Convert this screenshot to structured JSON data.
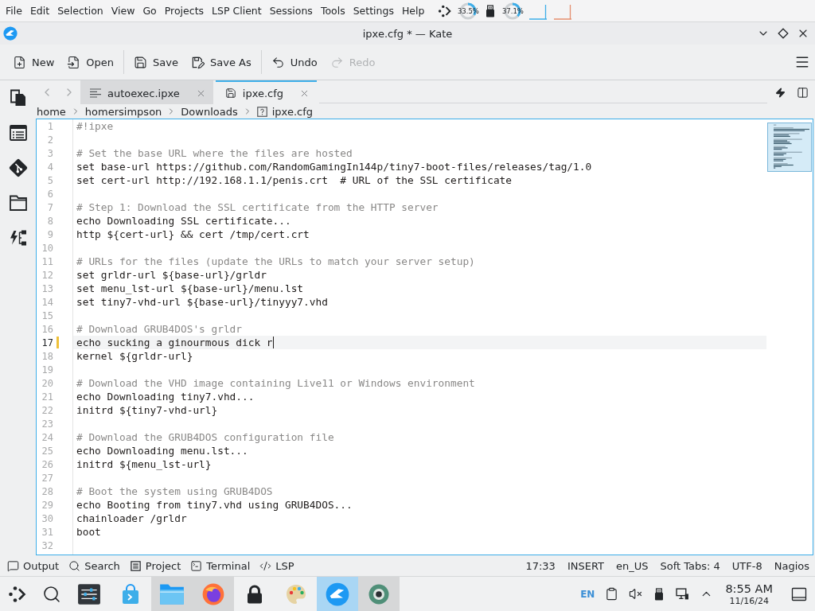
{
  "menu_bar": {
    "items": [
      "File",
      "Edit",
      "Selection",
      "View",
      "Go",
      "Projects",
      "LSP Client",
      "Sessions",
      "Tools",
      "Settings",
      "Help"
    ]
  },
  "system_monitor": {
    "gauges": [
      {
        "reading": "33.5%",
        "level": 0.335
      },
      {
        "reading": "37.1%",
        "level": 0.371
      }
    ]
  },
  "window": {
    "title": "ipxe.cfg * — Kate"
  },
  "toolbar": {
    "groups": [
      [
        {
          "label": "New",
          "disabled": false
        },
        {
          "label": "Open",
          "disabled": false
        }
      ],
      [
        {
          "label": "Save",
          "disabled": false
        },
        {
          "label": "Save As",
          "disabled": false
        }
      ],
      [
        {
          "label": "Undo",
          "disabled": false
        },
        {
          "label": "Redo",
          "disabled": true
        }
      ]
    ]
  },
  "tabs": [
    {
      "label": "autoexec.ipxe",
      "selected": false,
      "modified": false
    },
    {
      "label": "ipxe.cfg",
      "selected": true,
      "modified": true
    }
  ],
  "breadcrumb": [
    "home",
    "homersimpson",
    "Downloads",
    "ipxe.cfg"
  ],
  "editor": {
    "lines": [
      {
        "number": "1",
        "kind": "comment",
        "text": "#!ipxe",
        "current": false,
        "modified": false
      },
      {
        "number": "2",
        "kind": "blank",
        "current": false,
        "modified": false
      },
      {
        "number": "3",
        "kind": "comment",
        "text": "# Set the base URL where the files are hosted",
        "current": false,
        "modified": false
      },
      {
        "number": "4",
        "kind": "code",
        "text": "set base-url https://github.com/RandomGamingIn144p/tiny7-boot-files/releases/tag/1.0",
        "current": false,
        "modified": false
      },
      {
        "number": "5",
        "kind": "code",
        "text": "set cert-url http://192.168.1.1/penis.crt  # URL of the SSL certificate",
        "current": false,
        "modified": false
      },
      {
        "number": "6",
        "kind": "blank",
        "current": false,
        "modified": false
      },
      {
        "number": "7",
        "kind": "comment",
        "text": "# Step 1: Download the SSL certificate from the HTTP server",
        "current": false,
        "modified": false
      },
      {
        "number": "8",
        "kind": "code",
        "text": "echo Downloading SSL certificate...",
        "current": false,
        "modified": false
      },
      {
        "number": "9",
        "kind": "code",
        "text": "http ${cert-url} && cert /tmp/cert.crt",
        "current": false,
        "modified": false
      },
      {
        "number": "10",
        "kind": "blank",
        "current": false,
        "modified": false
      },
      {
        "number": "11",
        "kind": "comment",
        "text": "# URLs for the files (update the URLs to match your server setup)",
        "current": false,
        "modified": false
      },
      {
        "number": "12",
        "kind": "code",
        "text": "set grldr-url ${base-url}/grldr",
        "current": false,
        "modified": false
      },
      {
        "number": "13",
        "kind": "code",
        "text": "set menu_lst-url ${base-url}/menu.lst",
        "current": false,
        "modified": false
      },
      {
        "number": "14",
        "kind": "code",
        "text": "set tiny7-vhd-url ${base-url}/tinyyy7.vhd",
        "current": false,
        "modified": false
      },
      {
        "number": "15",
        "kind": "blank",
        "current": false,
        "modified": false
      },
      {
        "number": "16",
        "kind": "comment",
        "text": "# Download GRUB4DOS's grldr",
        "current": false,
        "modified": false
      },
      {
        "number": "17",
        "kind": "code",
        "text": "echo sucking a ginourmous dick r",
        "current": true,
        "modified": true
      },
      {
        "number": "18",
        "kind": "code",
        "text": "kernel ${grldr-url}",
        "current": false,
        "modified": false
      },
      {
        "number": "19",
        "kind": "blank",
        "current": false,
        "modified": false
      },
      {
        "number": "20",
        "kind": "comment",
        "text": "# Download the VHD image containing Live11 or Windows environment",
        "current": false,
        "modified": false
      },
      {
        "number": "21",
        "kind": "code",
        "text": "echo Downloading tiny7.vhd...",
        "current": false,
        "modified": false
      },
      {
        "number": "22",
        "kind": "code",
        "text": "initrd ${tiny7-vhd-url}",
        "current": false,
        "modified": false
      },
      {
        "number": "23",
        "kind": "blank",
        "current": false,
        "modified": false
      },
      {
        "number": "24",
        "kind": "comment",
        "text": "# Download the GRUB4DOS configuration file",
        "current": false,
        "modified": false
      },
      {
        "number": "25",
        "kind": "code",
        "text": "echo Downloading menu.lst...",
        "current": false,
        "modified": false
      },
      {
        "number": "26",
        "kind": "code",
        "text": "initrd ${menu_lst-url}",
        "current": false,
        "modified": false
      },
      {
        "number": "27",
        "kind": "blank",
        "current": false,
        "modified": false
      },
      {
        "number": "28",
        "kind": "comment",
        "text": "# Boot the system using GRUB4DOS",
        "current": false,
        "modified": false
      },
      {
        "number": "29",
        "kind": "code",
        "text": "echo Booting from tiny7.vhd using GRUB4DOS...",
        "current": false,
        "modified": false
      },
      {
        "number": "30",
        "kind": "code",
        "text": "chainloader /grldr",
        "current": false,
        "modified": false
      },
      {
        "number": "31",
        "kind": "code",
        "text": "boot",
        "current": false,
        "modified": false
      },
      {
        "number": "32",
        "kind": "blank",
        "current": false,
        "modified": false
      }
    ]
  },
  "status_bar": {
    "tool_views": [
      "Output",
      "Search",
      "Project",
      "Terminal",
      "LSP"
    ],
    "info": [
      "17:33",
      "INSERT",
      "en_US",
      "Soft Tabs: 4",
      "UTF-8",
      "Nagios"
    ]
  },
  "taskbar": {
    "apps": [
      {
        "open": false,
        "selected": false
      },
      {
        "open": false,
        "selected": false
      },
      {
        "open": true,
        "selected": false
      },
      {
        "open": true,
        "selected": false
      },
      {
        "open": false,
        "selected": false
      },
      {
        "open": false,
        "selected": false
      },
      {
        "open": true,
        "selected": true
      },
      {
        "open": true,
        "selected": false
      }
    ]
  },
  "tray": {
    "keyboard_layout": "EN",
    "time": "8:55 AM",
    "date": "11/16/24"
  }
}
